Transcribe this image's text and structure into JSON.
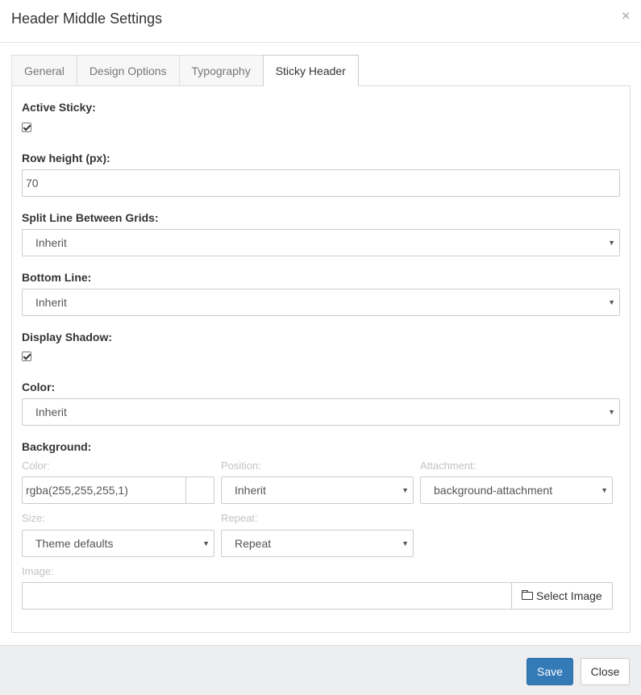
{
  "modal": {
    "title": "Header Middle Settings",
    "close_glyph": "×"
  },
  "tabs": [
    {
      "label": "General",
      "active": false
    },
    {
      "label": "Design Options",
      "active": false
    },
    {
      "label": "Typography",
      "active": false
    },
    {
      "label": "Sticky Header",
      "active": true
    }
  ],
  "form": {
    "active_sticky": {
      "label": "Active Sticky:",
      "checked": true
    },
    "row_height": {
      "label": "Row height (px):",
      "value": "70"
    },
    "split_line": {
      "label": "Split Line Between Grids:",
      "value": "Inherit"
    },
    "bottom_line": {
      "label": "Bottom Line:",
      "value": "Inherit"
    },
    "display_shadow": {
      "label": "Display Shadow:",
      "checked": true
    },
    "color": {
      "label": "Color:",
      "value": "Inherit"
    },
    "background": {
      "label": "Background:",
      "color": {
        "label": "Color:",
        "value": "rgba(255,255,255,1)"
      },
      "position": {
        "label": "Position:",
        "value": "Inherit"
      },
      "attachment": {
        "label": "Attachment:",
        "value": "background-attachment"
      },
      "size": {
        "label": "Size:",
        "value": "Theme defaults"
      },
      "repeat": {
        "label": "Repeat:",
        "value": "Repeat"
      },
      "image": {
        "label": "Image:",
        "value": "",
        "button_label": "Select Image",
        "button_icon": "folder-open-icon"
      }
    }
  },
  "footer": {
    "save_label": "Save",
    "close_label": "Close"
  },
  "colors": {
    "primary": "#337ab7",
    "footer_bg": "#eceeef",
    "border": "#cccccc"
  }
}
